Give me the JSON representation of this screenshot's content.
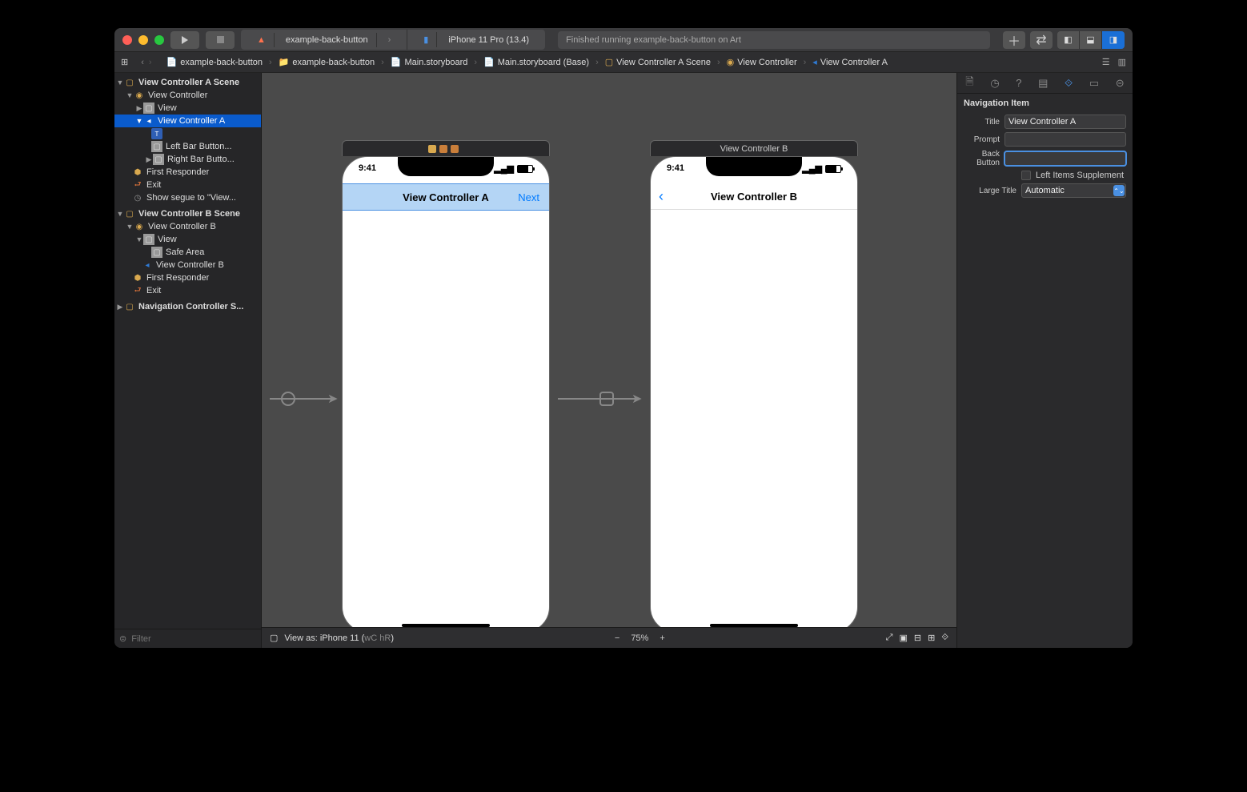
{
  "toolbar": {
    "scheme_project": "example-back-button",
    "scheme_device": "iPhone 11 Pro (13.4)",
    "status": "Finished running example-back-button on Art"
  },
  "breadcrumb": {
    "items": [
      "example-back-button",
      "example-back-button",
      "Main.storyboard",
      "Main.storyboard (Base)",
      "View Controller A Scene",
      "View Controller",
      "View Controller A"
    ]
  },
  "outline": {
    "sceneA": "View Controller A Scene",
    "vcA": "View Controller",
    "viewA": "View",
    "navItemA": "View Controller A",
    "titleItem": "",
    "leftBar": "Left Bar Button...",
    "rightBar": "Right Bar Butto...",
    "firstRespA": "First Responder",
    "exitA": "Exit",
    "segue": "Show segue to \"View...",
    "sceneB": "View Controller B Scene",
    "vcB": "View Controller B",
    "viewB": "View",
    "safeArea": "Safe Area",
    "navItemB": "View Controller B",
    "firstRespB": "First Responder",
    "exitB": "Exit",
    "navScene": "Navigation Controller S..."
  },
  "filter_placeholder": "Filter",
  "canvas": {
    "sceneA_label": "",
    "sceneA_title": "View Controller A",
    "sceneA_next": "Next",
    "sceneB_label": "View Controller B",
    "sceneB_title": "View Controller B",
    "time": "9:41"
  },
  "bottom": {
    "view_as": "View as: iPhone 11 (",
    "view_as_suffix": ")",
    "wc": "wC",
    "hr": "hR",
    "zoom": "75%"
  },
  "inspector": {
    "section": "Navigation Item",
    "title_label": "Title",
    "title_value": "View Controller A",
    "prompt_label": "Prompt",
    "prompt_value": "",
    "back_label": "Back Button",
    "back_value": "",
    "left_supp": "Left Items Supplement",
    "large_label": "Large Title",
    "large_value": "Automatic"
  }
}
